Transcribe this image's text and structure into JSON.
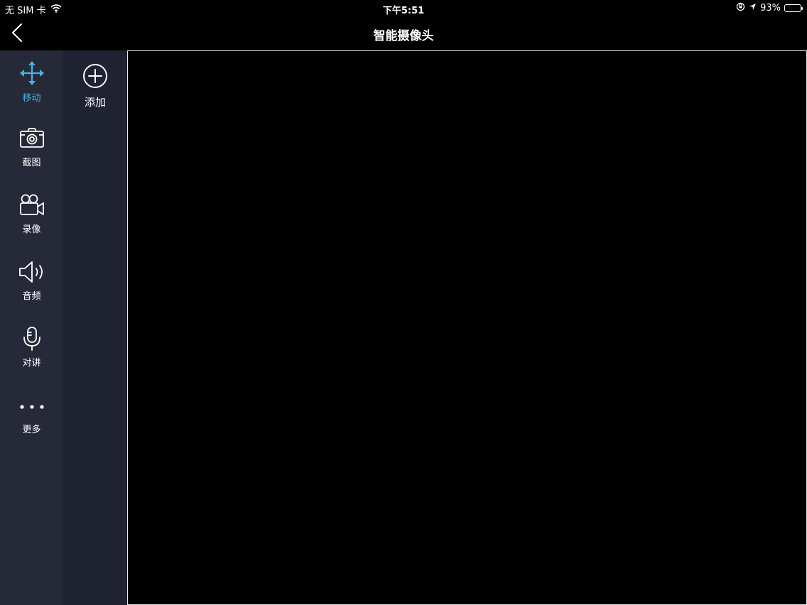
{
  "status_bar": {
    "carrier": "无 SIM 卡",
    "time": "下午5:51",
    "battery": "93%",
    "battery_level": 0.93,
    "icons": [
      "wifi-icon",
      "rotation-lock-icon",
      "location-icon",
      "battery-icon"
    ]
  },
  "nav": {
    "title": "智能摄像头",
    "back_icon": "chevron-left-icon"
  },
  "tools": [
    {
      "label": "移动",
      "icon": "move-arrows-icon",
      "active": true
    },
    {
      "label": "截图",
      "icon": "camera-icon",
      "active": false
    },
    {
      "label": "录像",
      "icon": "video-camera-icon",
      "active": false
    },
    {
      "label": "音频",
      "icon": "speaker-icon",
      "active": false
    },
    {
      "label": "对讲",
      "icon": "microphone-icon",
      "active": false
    },
    {
      "label": "更多",
      "icon": "more-dots-icon",
      "active": false
    }
  ],
  "devices": {
    "add_label": "添加",
    "add_icon": "plus-circle-icon"
  },
  "colors": {
    "accent": "#4ab0e8",
    "tools_bg": "#262a38",
    "devices_bg": "#1e2231",
    "video_border": "#e6e6e6"
  }
}
